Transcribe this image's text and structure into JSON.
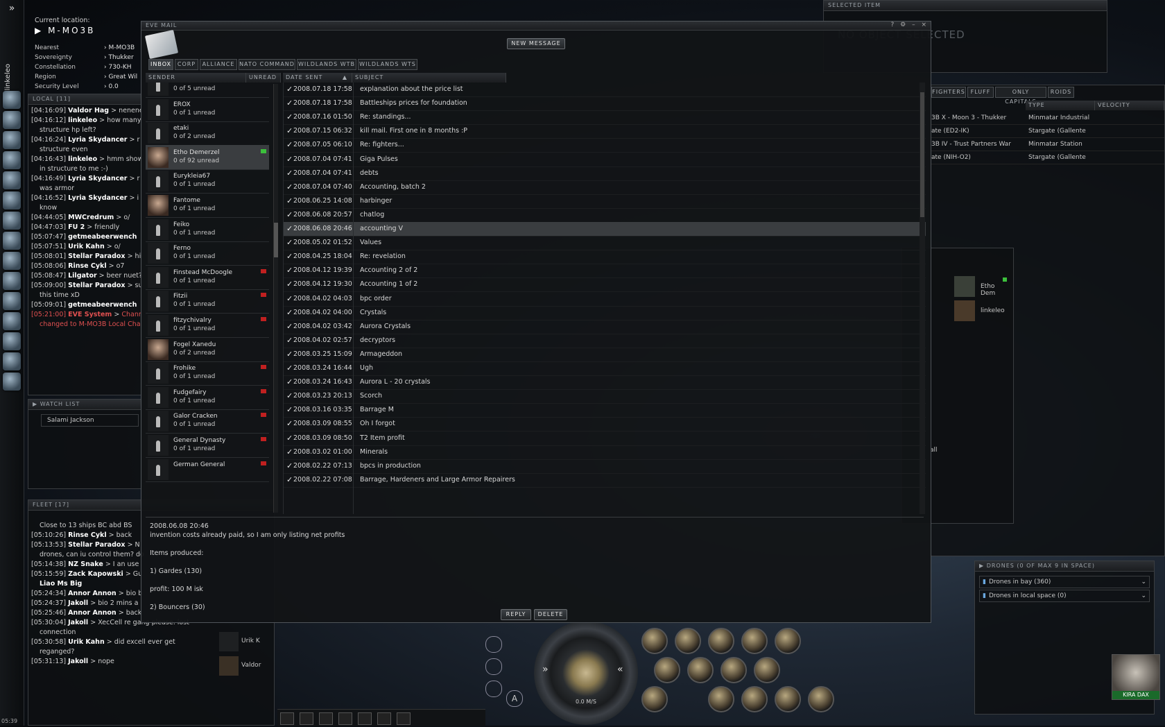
{
  "neocom": {
    "char_name": "linkeleo",
    "clock": "05:39"
  },
  "location": {
    "label": "Current location:",
    "system": "M-MO3B",
    "rows": [
      {
        "k": "Nearest",
        "v": "M-MO3B"
      },
      {
        "k": "Sovereignty",
        "v": "Thukker"
      },
      {
        "k": "Constellation",
        "v": "730-KH"
      },
      {
        "k": "Region",
        "v": "Great Wil"
      },
      {
        "k": "Security Level",
        "v": "0.0"
      }
    ]
  },
  "local": {
    "title": "LOCAL [11]",
    "lines": [
      {
        "t": "[04:16:09]",
        "n": "Valdor Hag",
        "m": "nenene"
      },
      {
        "t": "[04:16:12]",
        "n": "linkeleo",
        "m": "how many"
      },
      {
        "t": "",
        "n": "",
        "m": "structure hp left?"
      },
      {
        "t": "[04:16:24]",
        "n": "Lyria Skydancer",
        "m": "r"
      },
      {
        "t": "",
        "n": "",
        "m": "structure even"
      },
      {
        "t": "[04:16:43]",
        "n": "linkeleo",
        "m": "hmm show"
      },
      {
        "t": "",
        "n": "",
        "m": "in structure to me :-)"
      },
      {
        "t": "[04:16:49]",
        "n": "Lyria Skydancer",
        "m": "r"
      },
      {
        "t": "",
        "n": "",
        "m": "was armor"
      },
      {
        "t": "[04:16:52]",
        "n": "Lyria Skydancer",
        "m": "i"
      },
      {
        "t": "",
        "n": "",
        "m": "know"
      },
      {
        "t": "[04:44:05]",
        "n": "MWCredrum",
        "m": "o/"
      },
      {
        "t": "[04:47:03]",
        "n": "FU 2",
        "m": "friendly"
      },
      {
        "t": "[05:07:47]",
        "n": "getmeabeerwench",
        "m": ""
      },
      {
        "t": "[05:07:51]",
        "n": "Urik Kahn",
        "m": "o/"
      },
      {
        "t": "[05:08:01]",
        "n": "Stellar Paradox",
        "m": "hi"
      },
      {
        "t": "[05:08:06]",
        "n": "Rinse Cykl",
        "m": "o7"
      },
      {
        "t": "[05:08:47]",
        "n": "Lilgator",
        "m": "beer nuet?"
      },
      {
        "t": "[05:09:00]",
        "n": "Stellar Paradox",
        "m": "su"
      },
      {
        "t": "",
        "n": "",
        "m": "this time xD"
      },
      {
        "t": "[05:09:01]",
        "n": "getmeabeerwench",
        "m": ""
      },
      {
        "t": "[05:21:00]",
        "n": "EVE System",
        "m": "Chann",
        "sys": true
      },
      {
        "t": "",
        "n": "",
        "m": "changed to M-MO3B Local Chan",
        "sys": true
      }
    ]
  },
  "watch": {
    "title": "WATCH LIST",
    "items": [
      "Salami Jackson"
    ]
  },
  "fleet": {
    "title": "FLEET [17]",
    "lines": [
      {
        "t": "",
        "n": "",
        "m": "Close to 13 ships BC abd BS"
      },
      {
        "t": "[05:10:26]",
        "n": "Rinse Cykl",
        "m": "back"
      },
      {
        "t": "[05:13:53]",
        "n": "Stellar Paradox",
        "m": "N"
      },
      {
        "t": "",
        "n": "",
        "m": "drones, can iu control them? do"
      },
      {
        "t": "[05:14:38]",
        "n": "NZ Snake",
        "m": "I an use"
      },
      {
        "t": "[05:15:59]",
        "n": "Zack Kapowski",
        "m": "Gu"
      },
      {
        "t": "",
        "n": "Liao Ms Big",
        "m": ""
      },
      {
        "t": "[05:24:34]",
        "n": "Annor Annon",
        "m": "bio b"
      },
      {
        "t": "[05:24:37]",
        "n": "Jakoll",
        "m": "bio 2 mins a"
      },
      {
        "t": "[05:25:46]",
        "n": "Annor Annon",
        "m": "back"
      },
      {
        "t": "[05:30:04]",
        "n": "Jakoll",
        "m": "XecCell re gang please. lost"
      },
      {
        "t": "",
        "n": "",
        "m": "connection"
      },
      {
        "t": "[05:30:58]",
        "n": "Urik Kahn",
        "m": "did excell ever get"
      },
      {
        "t": "",
        "n": "",
        "m": "reganged?"
      },
      {
        "t": "[05:31:13]",
        "n": "Jakoll",
        "m": "nope"
      }
    ],
    "members": [
      "Urik K",
      "Valdor"
    ]
  },
  "mail": {
    "title": "EVE MAIL",
    "new_message": "NEW MESSAGE",
    "tabs": [
      "INBOX",
      "CORP",
      "ALLIANCE",
      "NATO COMMAND",
      "WILDLANDS WTB",
      "WILDLANDS WTS"
    ],
    "col_sender": "SENDER",
    "col_unread": "UNREAD",
    "col_date": "DATE SENT",
    "col_subject": "SUBJECT",
    "senders": [
      {
        "name": "",
        "count": "0 of 5 unread",
        "flag": ""
      },
      {
        "name": "EROX",
        "count": "0 of 1 unread",
        "flag": ""
      },
      {
        "name": "etaki",
        "count": "0 of 2 unread",
        "flag": ""
      },
      {
        "name": "Etho Demerzel",
        "count": "0 of 92 unread",
        "flag": "#3cc03c",
        "sel": true,
        "portrait": true
      },
      {
        "name": "Eurykleia67",
        "count": "0 of 1 unread",
        "flag": ""
      },
      {
        "name": "Fantome",
        "count": "0 of 1 unread",
        "flag": "",
        "portrait": true
      },
      {
        "name": "Feiko",
        "count": "0 of 1 unread",
        "flag": ""
      },
      {
        "name": "Ferno",
        "count": "0 of 1 unread",
        "flag": ""
      },
      {
        "name": "Finstead McDoogle",
        "count": "0 of 1 unread",
        "flag": "#c02020"
      },
      {
        "name": "Fitzii",
        "count": "0 of 1 unread",
        "flag": "#c02020"
      },
      {
        "name": "fitzychivalry",
        "count": "0 of 1 unread",
        "flag": "#c02020"
      },
      {
        "name": "Fogel Xanedu",
        "count": "0 of 2 unread",
        "flag": "",
        "portrait": true
      },
      {
        "name": "Frohike",
        "count": "0 of 1 unread",
        "flag": "#c02020"
      },
      {
        "name": "Fudgefairy",
        "count": "0 of 1 unread",
        "flag": "#c02020"
      },
      {
        "name": "Galor Cracken",
        "count": "0 of 1 unread",
        "flag": "#c02020"
      },
      {
        "name": "General Dynasty",
        "count": "0 of 1 unread",
        "flag": "#c02020"
      },
      {
        "name": "German General",
        "count": "",
        "flag": "#c02020"
      }
    ],
    "messages": [
      {
        "d": "2008.07.18 17:58",
        "s": "explanation about the price list"
      },
      {
        "d": "2008.07.18 17:58",
        "s": "Battleships prices for foundation"
      },
      {
        "d": "2008.07.16 01:50",
        "s": "Re: standings..."
      },
      {
        "d": "2008.07.15 06:32",
        "s": "kill mail. First one in 8 months :P"
      },
      {
        "d": "2008.07.05 06:10",
        "s": "Re: fighters..."
      },
      {
        "d": "2008.07.04 07:41",
        "s": "Giga Pulses"
      },
      {
        "d": "2008.07.04 07:41",
        "s": "debts"
      },
      {
        "d": "2008.07.04 07:40",
        "s": "Accounting, batch 2"
      },
      {
        "d": "2008.06.25 14:08",
        "s": "harbinger"
      },
      {
        "d": "2008.06.08 20:57",
        "s": "chatlog"
      },
      {
        "d": "2008.06.08 20:46",
        "s": "accounting V",
        "sel": true
      },
      {
        "d": "2008.05.02 01:52",
        "s": "Values"
      },
      {
        "d": "2008.04.25 18:04",
        "s": "Re: revelation"
      },
      {
        "d": "2008.04.12 19:39",
        "s": "Accounting 2 of 2"
      },
      {
        "d": "2008.04.12 19:30",
        "s": "Accounting 1 of 2"
      },
      {
        "d": "2008.04.02 04:03",
        "s": "bpc order"
      },
      {
        "d": "2008.04.02 04:00",
        "s": "Crystals"
      },
      {
        "d": "2008.04.02 03:42",
        "s": "Aurora Crystals"
      },
      {
        "d": "2008.04.02 02:57",
        "s": "decryptors"
      },
      {
        "d": "2008.03.25 15:09",
        "s": "Armageddon"
      },
      {
        "d": "2008.03.24 16:44",
        "s": "Ugh"
      },
      {
        "d": "2008.03.24 16:43",
        "s": "Aurora L - 20 crystals"
      },
      {
        "d": "2008.03.23 20:13",
        "s": "Scorch"
      },
      {
        "d": "2008.03.16 03:35",
        "s": "Barrage M"
      },
      {
        "d": "2008.03.09 08:55",
        "s": "Oh I forgot"
      },
      {
        "d": "2008.03.09 08:50",
        "s": "T2 Item profit"
      },
      {
        "d": "2008.03.02 01:00",
        "s": "Minerals"
      },
      {
        "d": "2008.02.22 07:13",
        "s": "bpcs in production"
      },
      {
        "d": "2008.02.22 07:08",
        "s": "Barrage, Hardeners and Large Armor Repairers"
      }
    ],
    "body": {
      "date": "2008.06.08 20:46",
      "lines": [
        "invention costs already paid, so I am only listing net profits",
        "",
        "Items produced:",
        "",
        "1) Gardes (130)",
        "",
        "profit: 100 M isk",
        "",
        "2) Bouncers (30)"
      ]
    },
    "reply": "REPLY",
    "delete": "DELETE"
  },
  "selected_item": {
    "title": "SELECTED ITEM",
    "text": "NO OBJECT SELECTED"
  },
  "overview": {
    "tabs": [
      "FIGHTERS",
      "FLUFF",
      "ONLY CAPITALS",
      "ROIDS"
    ],
    "col_type": "TYPE",
    "col_velocity": "VELOCITY",
    "rows": [
      {
        "name": "3B X - Moon 3 - Thukker",
        "type": "Minmatar Industrial"
      },
      {
        "name": "ate (ED2-IK)",
        "type": "Stargate (Gallente"
      },
      {
        "name": "3B IV - Trust Partners War",
        "type": "Minmatar Station"
      },
      {
        "name": "ate (NIH-O2)",
        "type": "Stargate (Gallente"
      }
    ]
  },
  "members_panel": {
    "members": [
      "Etho Dem",
      "linkeleo"
    ],
    "fragment": "all"
  },
  "drones": {
    "title": "DRONES (0 OF MAX 9 IN SPACE)",
    "rows": [
      "Drones in bay (360)",
      "Drones in local space (0)"
    ]
  },
  "hud": {
    "speed": "0.0 M/S"
  },
  "pilot": {
    "name": "KIRA DAX"
  }
}
